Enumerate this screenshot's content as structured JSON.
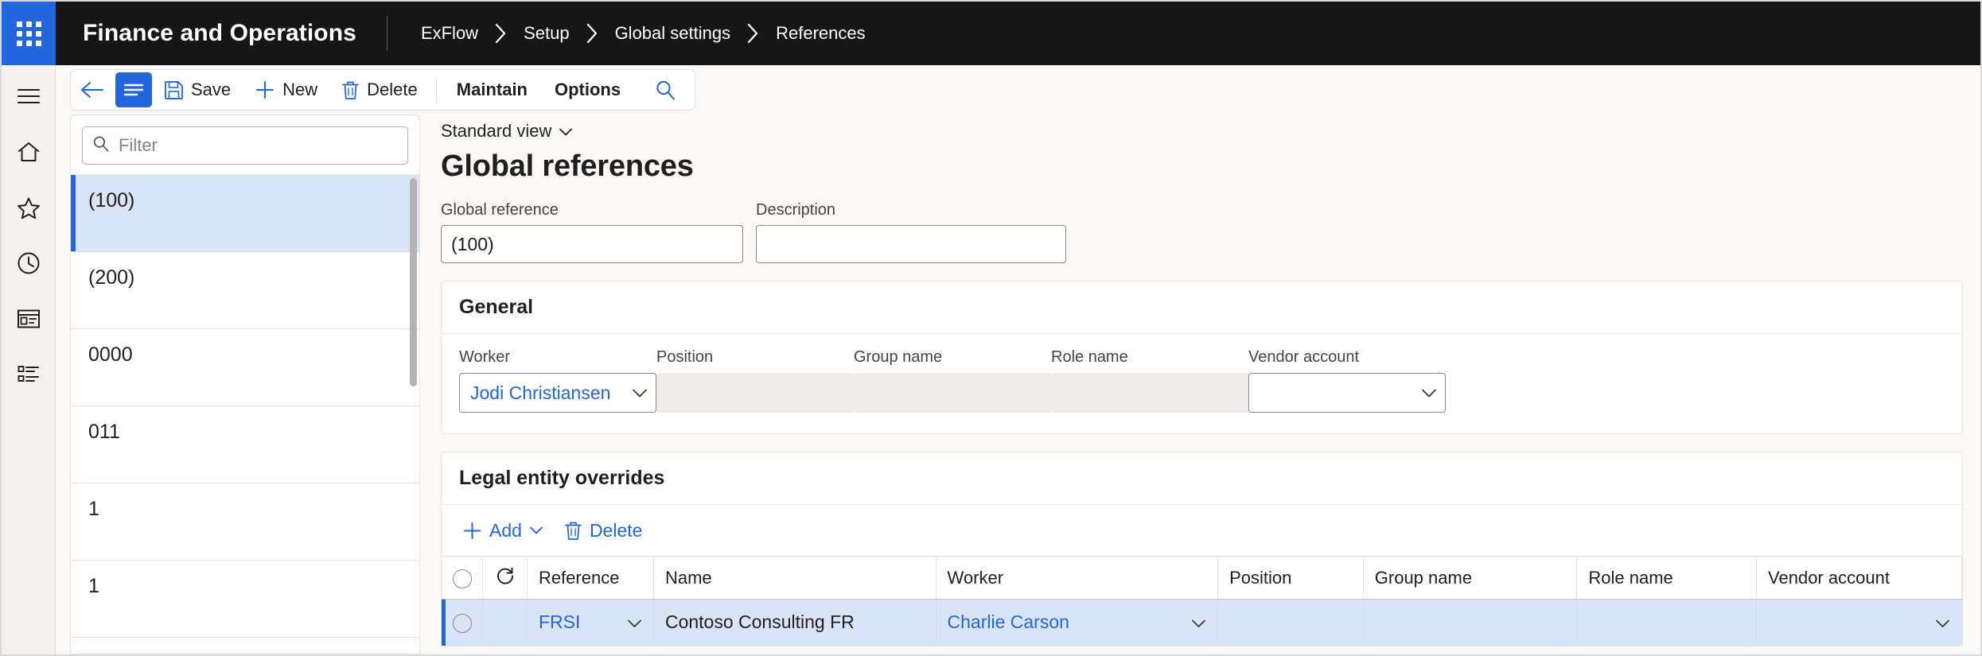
{
  "topbar": {
    "waffle_icon": "app-launcher-icon",
    "app_title": "Finance and Operations",
    "breadcrumb": [
      "ExFlow",
      "Setup",
      "Global settings",
      "References"
    ]
  },
  "rail": {
    "items": [
      {
        "icon": "hamburger-icon",
        "name": "navigation-menu"
      },
      {
        "icon": "home-icon",
        "name": "home"
      },
      {
        "icon": "star-icon",
        "name": "favorites"
      },
      {
        "icon": "clock-icon",
        "name": "recent"
      },
      {
        "icon": "workspace-icon",
        "name": "workspaces"
      },
      {
        "icon": "list-icon",
        "name": "modules"
      }
    ]
  },
  "commandbar": {
    "back_icon": "back-arrow-icon",
    "toggle_icon": "show-list-icon",
    "save_label": "Save",
    "save_icon": "save-icon",
    "new_label": "New",
    "new_icon": "plus-icon",
    "delete_label": "Delete",
    "delete_icon": "trash-icon",
    "maintain_label": "Maintain",
    "options_label": "Options",
    "search_icon": "search-icon"
  },
  "listpanel": {
    "filter_placeholder": "Filter",
    "filter_value": "",
    "filter_icon": "search-icon",
    "items": [
      {
        "label": "(100)",
        "selected": true
      },
      {
        "label": "(200)",
        "selected": false
      },
      {
        "label": "0000",
        "selected": false
      },
      {
        "label": "011",
        "selected": false
      },
      {
        "label": "1",
        "selected": false
      },
      {
        "label": "1",
        "selected": false
      }
    ]
  },
  "form": {
    "view_selector": "Standard view",
    "view_selector_icon": "chevron-down-icon",
    "page_title": "Global references",
    "header_fields": [
      {
        "label": "Global reference",
        "value": "(100)"
      },
      {
        "label": "Description",
        "value": ""
      }
    ],
    "general": {
      "title": "General",
      "fields": [
        {
          "label": "Worker",
          "value": "Jodi Christiansen",
          "type": "combo",
          "readonly": false
        },
        {
          "label": "Position",
          "value": "",
          "type": "readonly",
          "readonly": true
        },
        {
          "label": "Group name",
          "value": "",
          "type": "readonly",
          "readonly": true
        },
        {
          "label": "Role name",
          "value": "",
          "type": "readonly",
          "readonly": true
        },
        {
          "label": "Vendor account",
          "value": "",
          "type": "combo",
          "readonly": false
        }
      ]
    },
    "legal_entity_overrides": {
      "title": "Legal entity overrides",
      "toolbar": {
        "add_label": "Add",
        "add_icon": "plus-icon",
        "add_chevron_icon": "chevron-down-icon",
        "delete_label": "Delete",
        "delete_icon": "trash-icon"
      },
      "columns": [
        "Reference",
        "Name",
        "Worker",
        "Position",
        "Group name",
        "Role name",
        "Vendor account"
      ],
      "select_header_icon": "select-all-circle-icon",
      "refresh_header_icon": "refresh-icon",
      "rows": [
        {
          "selected": true,
          "reference": "FRSI",
          "name": "Contoso Consulting FR",
          "worker": "Charlie Carson",
          "position": "",
          "group_name": "",
          "role_name": "",
          "vendor_account": ""
        }
      ]
    }
  },
  "colors": {
    "accent": "#2266dd",
    "topbar_bg": "#161616",
    "selection_bg": "#d9e4f7",
    "readonly_bg": "#efedeb"
  }
}
